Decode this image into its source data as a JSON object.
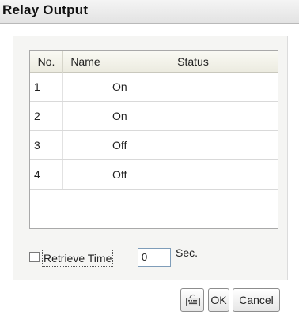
{
  "dialog": {
    "title": "Relay Output"
  },
  "table": {
    "headers": {
      "no": "No.",
      "name": "Name",
      "status": "Status"
    },
    "rows": [
      {
        "no": "1",
        "name": "",
        "status": "On"
      },
      {
        "no": "2",
        "name": "",
        "status": "On"
      },
      {
        "no": "3",
        "name": "",
        "status": "Off"
      },
      {
        "no": "4",
        "name": "",
        "status": "Off"
      }
    ]
  },
  "retrieve": {
    "label": "Retrieve Time",
    "checked": false,
    "value": "0",
    "unit": "Sec."
  },
  "buttons": {
    "keyboard_icon": "keyboard-icon",
    "ok": "OK",
    "cancel": "Cancel"
  }
}
